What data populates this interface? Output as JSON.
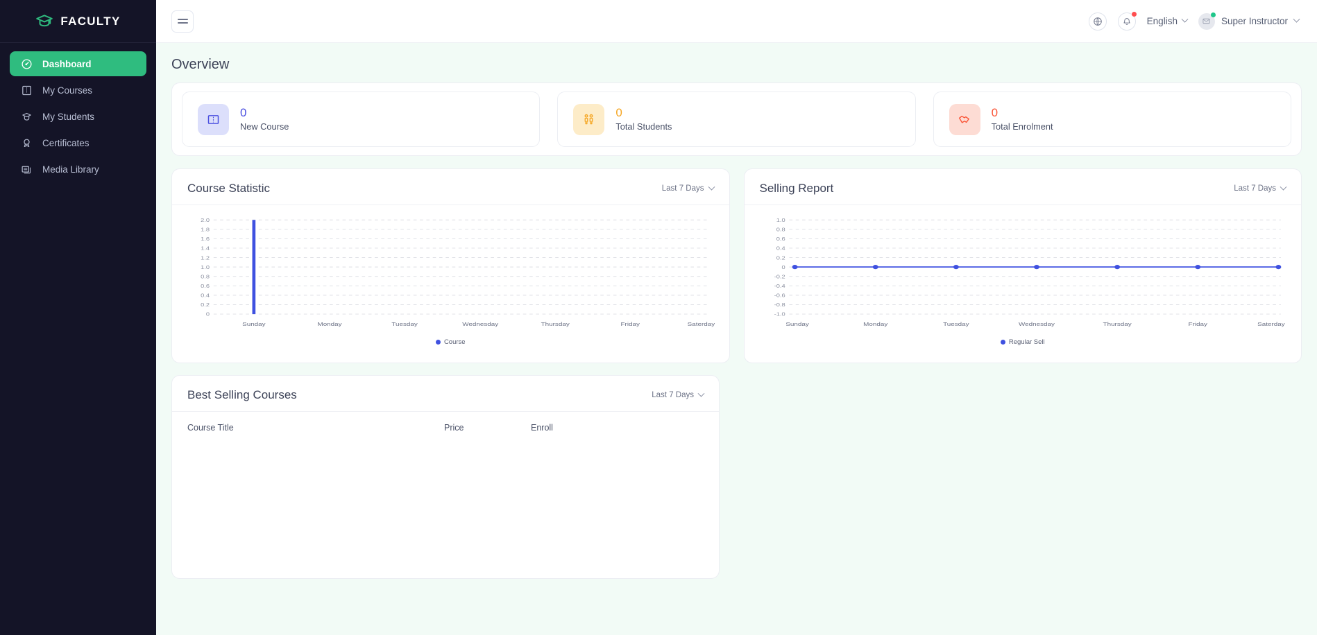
{
  "brand": {
    "name": "FACULTY",
    "logo_icon": "graduation-cap-icon"
  },
  "sidebar": {
    "items": [
      {
        "label": "Dashboard",
        "icon": "speedometer-icon",
        "active": true
      },
      {
        "label": "My Courses",
        "icon": "book-icon",
        "active": false
      },
      {
        "label": "My Students",
        "icon": "student-badge-icon",
        "active": false
      },
      {
        "label": "Certificates",
        "icon": "award-ribbon-icon",
        "active": false
      },
      {
        "label": "Media Library",
        "icon": "media-stack-icon",
        "active": false
      }
    ]
  },
  "topbar": {
    "menu_icon": "hamburger-icon",
    "globe_icon": "globe-icon",
    "bell_icon": "bell-icon",
    "language": "English",
    "user_name": "Super Instructor",
    "avatar_icon": "user-avatar-icon"
  },
  "page": {
    "title": "Overview"
  },
  "stats": [
    {
      "value": "0",
      "label": "New Course",
      "icon": "open-book-icon",
      "color": "#4a4fe0",
      "bg": "#dcdffb"
    },
    {
      "value": "0",
      "label": "Total Students",
      "icon": "people-icon",
      "color": "#f5a623",
      "bg": "#fdecc8"
    },
    {
      "value": "0",
      "label": "Total Enrolment",
      "icon": "handshake-icon",
      "color": "#fa5436",
      "bg": "#fddcd4"
    }
  ],
  "course_statistic": {
    "title": "Course Statistic",
    "filter": "Last 7 Days",
    "filter_icon": "chevron-down-icon"
  },
  "selling_report": {
    "title": "Selling Report",
    "filter": "Last 7 Days",
    "filter_icon": "chevron-down-icon"
  },
  "best_selling": {
    "title": "Best Selling Courses",
    "filter": "Last 7 Days",
    "filter_icon": "chevron-down-icon",
    "columns": [
      "Course Title",
      "Price",
      "Enroll"
    ],
    "rows": []
  },
  "chart_data": [
    {
      "type": "bar",
      "title": "Course Statistic",
      "categories": [
        "Sunday",
        "Monday",
        "Tuesday",
        "Wednesday",
        "Thursday",
        "Friday",
        "Saterday"
      ],
      "series": [
        {
          "name": "Course",
          "values": [
            2,
            0,
            0,
            0,
            0,
            0,
            0
          ],
          "color": "#3f51e0"
        }
      ],
      "yticks": [
        "0",
        "0.2",
        "0.4",
        "0.6",
        "0.8",
        "1.0",
        "1.2",
        "1.4",
        "1.6",
        "1.8",
        "2.0"
      ],
      "ylim": [
        0,
        2
      ],
      "xlabel": "",
      "ylabel": "",
      "grid": true,
      "legend": [
        "Course"
      ],
      "legend_position": "bottom"
    },
    {
      "type": "line",
      "title": "Selling Report",
      "categories": [
        "Sunday",
        "Monday",
        "Tuesday",
        "Wednesday",
        "Thursday",
        "Friday",
        "Saterday"
      ],
      "series": [
        {
          "name": "Regular Sell",
          "values": [
            0,
            0,
            0,
            0,
            0,
            0,
            0
          ],
          "color": "#3f51e0"
        }
      ],
      "yticks": [
        "-1.0",
        "-0.8",
        "-0.6",
        "-0.4",
        "-0.2",
        "0",
        "0.2",
        "0.4",
        "0.6",
        "0.8",
        "1.0"
      ],
      "ylim": [
        -1,
        1
      ],
      "xlabel": "",
      "ylabel": "",
      "grid": true,
      "legend": [
        "Regular Sell"
      ],
      "legend_position": "bottom"
    }
  ],
  "colors": {
    "sidebar_bg": "#141427",
    "accent_green": "#2fbc7f",
    "content_bg": "#f2fbf6",
    "chart_blue": "#3f51e0"
  }
}
